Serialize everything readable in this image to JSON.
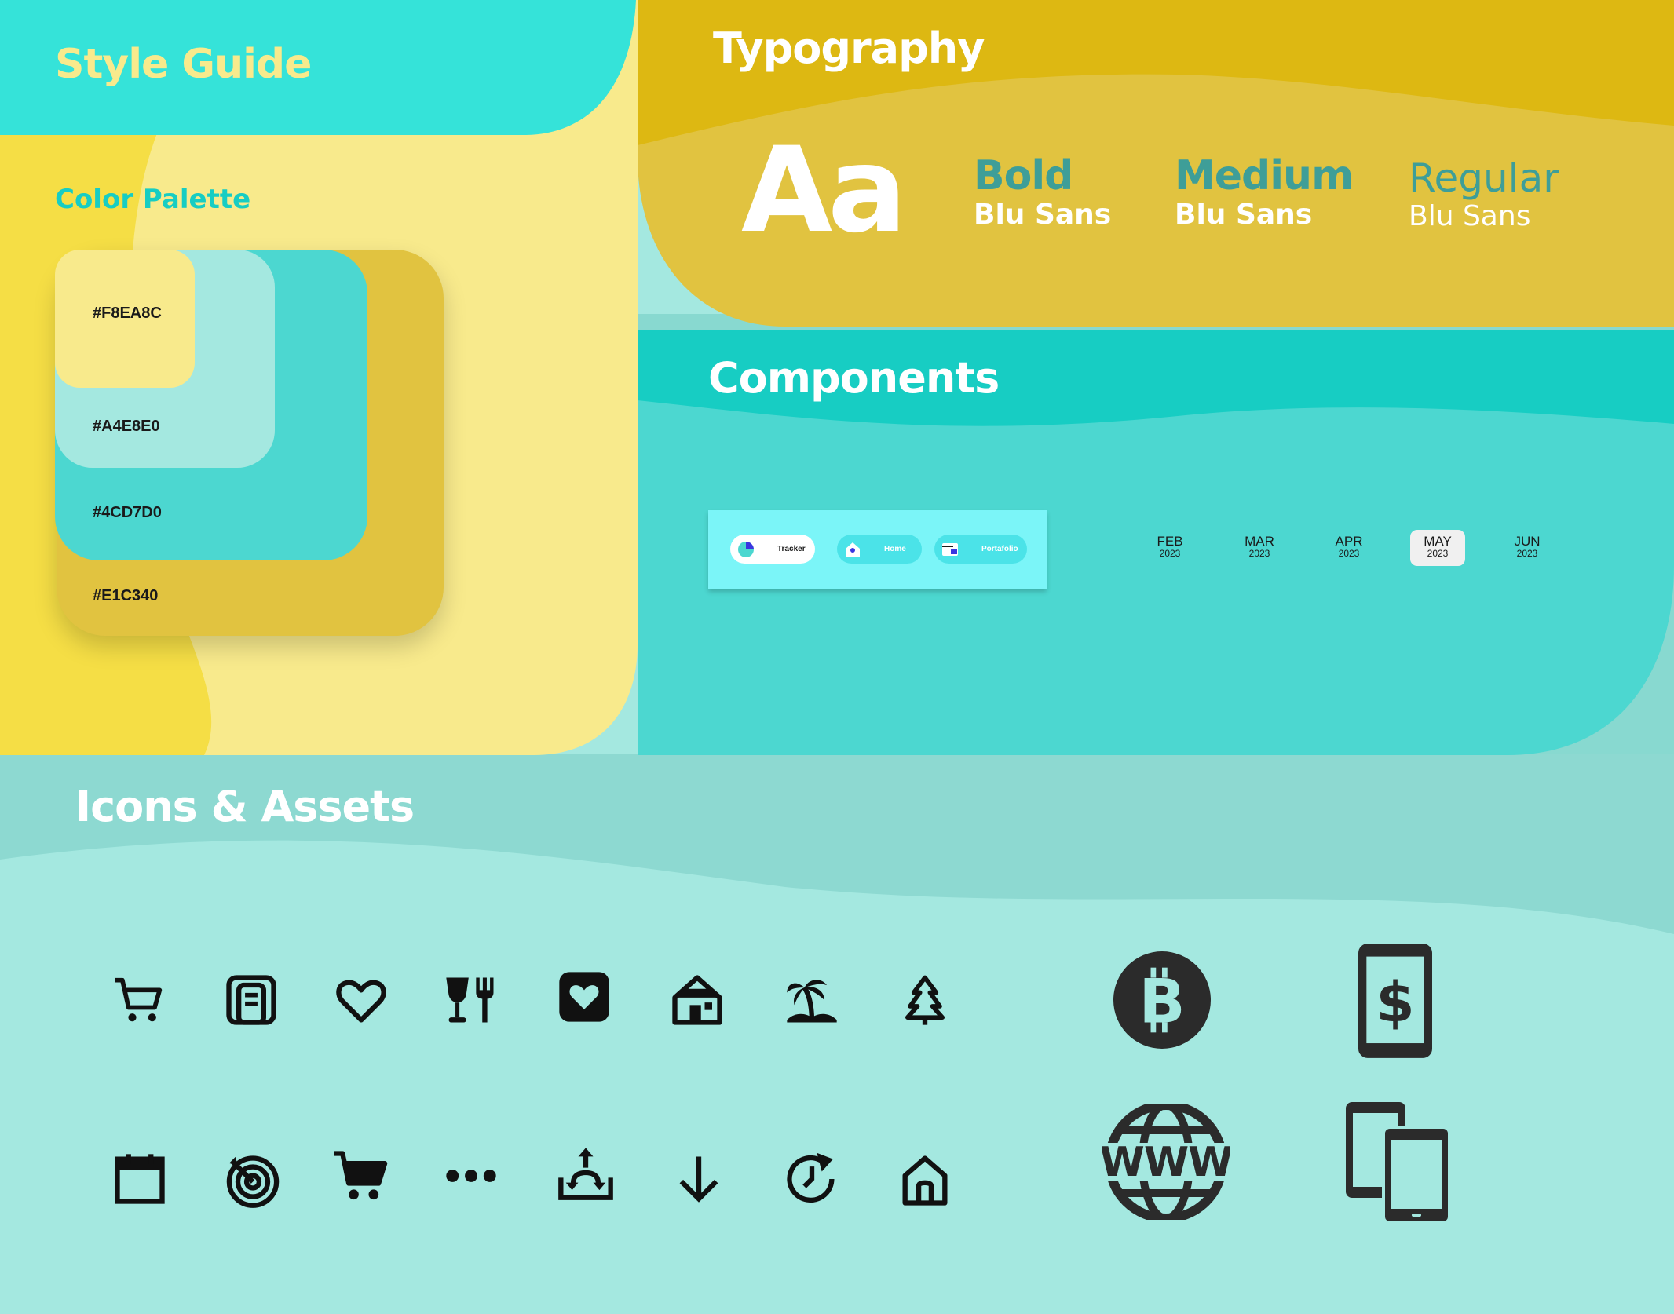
{
  "colors": {
    "yellow_light": "#F8EA8C",
    "aqua_light": "#A4E8E0",
    "aqua": "#4CD7D0",
    "gold": "#E1C340"
  },
  "style_guide": {
    "title": "Style Guide"
  },
  "color_palette": {
    "title": "Color Palette",
    "swatches": [
      {
        "label": "#F8EA8C",
        "color": "#F8EA8C"
      },
      {
        "label": "#A4E8E0",
        "color": "#A4E8E0"
      },
      {
        "label": "#4CD7D0",
        "color": "#4CD7D0"
      },
      {
        "label": "#E1C340",
        "color": "#E1C340"
      }
    ]
  },
  "typography": {
    "title": "Typography",
    "sample": "Aa",
    "weights": [
      {
        "weight": "Bold",
        "family": "Blu Sans"
      },
      {
        "weight": "Medium",
        "family": "Blu Sans"
      },
      {
        "weight": "Regular",
        "family": "Blu Sans"
      }
    ]
  },
  "components": {
    "title": "Components",
    "nav_pills": [
      {
        "label": "Tracker",
        "icon": "pie-chart-icon",
        "active": true
      },
      {
        "label": "Home",
        "icon": "home-icon",
        "active": false
      },
      {
        "label": "Portafolio",
        "icon": "wallet-icon",
        "active": false
      }
    ],
    "months": [
      {
        "month": "FEB",
        "year": "2023",
        "selected": false
      },
      {
        "month": "MAR",
        "year": "2023",
        "selected": false
      },
      {
        "month": "APR",
        "year": "2023",
        "selected": false
      },
      {
        "month": "MAY",
        "year": "2023",
        "selected": true
      },
      {
        "month": "JUN",
        "year": "2023",
        "selected": false
      }
    ]
  },
  "icons_assets": {
    "title": "Icons & Assets",
    "row1": [
      "cart-icon",
      "receipt-icon",
      "heart-icon",
      "food-drink-icon",
      "heart-square-icon",
      "house-icon",
      "palm-tree-icon",
      "pine-tree-icon"
    ],
    "row2": [
      "calendar-icon",
      "target-icon",
      "cart-filled-icon",
      "more-dots-icon",
      "share-out-icon",
      "arrow-down-icon",
      "refresh-clock-icon",
      "home-outline-icon"
    ],
    "assets": [
      "bitcoin-icon",
      "mobile-dollar-icon",
      "www-globe-icon",
      "devices-icon"
    ],
    "www_text": "WWW"
  }
}
